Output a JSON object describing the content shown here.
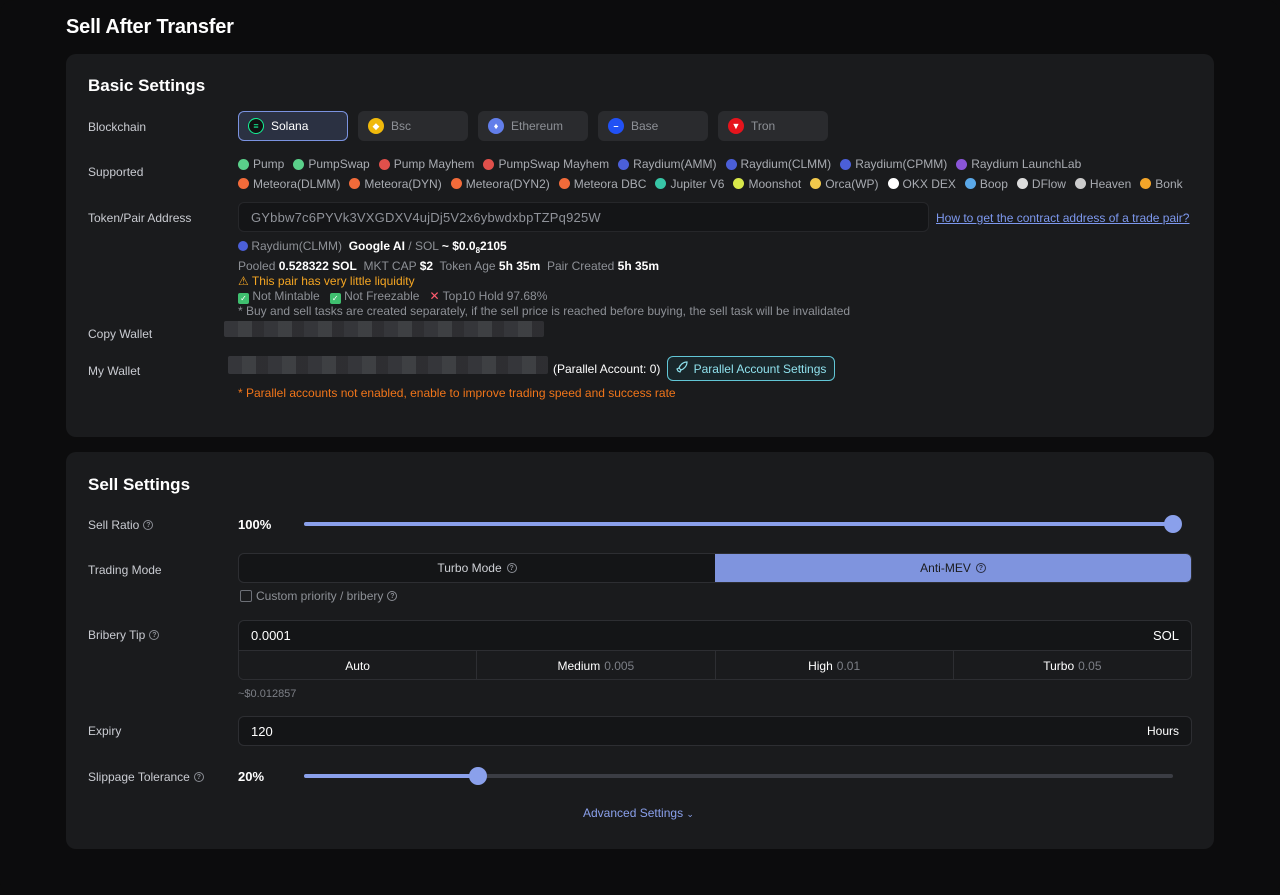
{
  "page": {
    "title": "Sell After Transfer"
  },
  "basic": {
    "title": "Basic Settings",
    "labels": {
      "blockchain": "Blockchain",
      "supported": "Supported",
      "token": "Token/Pair Address",
      "copy_wallet": "Copy Wallet",
      "my_wallet": "My Wallet"
    },
    "chains": [
      {
        "label": "Solana",
        "icon": "solana-icon",
        "color": "#14f195",
        "active": true
      },
      {
        "label": "Bsc",
        "icon": "bnb-icon",
        "color": "#f0b90b",
        "active": false
      },
      {
        "label": "Ethereum",
        "icon": "ethereum-icon",
        "color": "#627eea",
        "active": false
      },
      {
        "label": "Base",
        "icon": "base-icon",
        "color": "#2151f5",
        "active": false
      },
      {
        "label": "Tron",
        "icon": "tron-icon",
        "color": "#e5141c",
        "active": false
      }
    ],
    "dexes": [
      {
        "label": "Pump",
        "color": "#5ad08a"
      },
      {
        "label": "PumpSwap",
        "color": "#5ad08a"
      },
      {
        "label": "Pump Mayhem",
        "color": "#e0504b"
      },
      {
        "label": "PumpSwap Mayhem",
        "color": "#e0504b"
      },
      {
        "label": "Raydium(AMM)",
        "color": "#4b5fd8"
      },
      {
        "label": "Raydium(CLMM)",
        "color": "#4b5fd8"
      },
      {
        "label": "Raydium(CPMM)",
        "color": "#4b5fd8"
      },
      {
        "label": "Raydium LaunchLab",
        "color": "#8a55d8"
      },
      {
        "label": "Meteora(DLMM)",
        "color": "#f26b3a"
      },
      {
        "label": "Meteora(DYN)",
        "color": "#f26b3a"
      },
      {
        "label": "Meteora(DYN2)",
        "color": "#f26b3a"
      },
      {
        "label": "Meteora DBC",
        "color": "#f26b3a"
      },
      {
        "label": "Jupiter V6",
        "color": "#37c5a6"
      },
      {
        "label": "Moonshot",
        "color": "#d8e84a"
      },
      {
        "label": "Orca(WP)",
        "color": "#f2c94c"
      },
      {
        "label": "OKX DEX",
        "color": "#ffffff"
      },
      {
        "label": "Boop",
        "color": "#5aa8e8"
      },
      {
        "label": "DFlow",
        "color": "#dddddd"
      },
      {
        "label": "Heaven",
        "color": "#cccccc"
      },
      {
        "label": "Bonk",
        "color": "#f3a529"
      }
    ],
    "token": {
      "value": "GYbbw7c6PYVk3VXGDXV4ujDj5V2x6ybwdxbpTZPq925W",
      "help_link": "How to get the contract address of a trade pair?",
      "pool": "Raydium(CLMM)",
      "pair_name": "Google AI",
      "pair_quote": " / SOL",
      "price_prefix": "~ $0.0",
      "price_sub": "8",
      "price_suffix": "2105",
      "pooled_label": "Pooled",
      "pooled_value": "0.528322 SOL",
      "mktcap_label": "MKT CAP",
      "mktcap_value": "$2",
      "age_label": "Token Age",
      "age_value": "5h 35m",
      "created_label": "Pair Created",
      "created_value": "5h 35m",
      "warning": "This pair has very little liquidity",
      "not_mintable": "Not Mintable",
      "not_freezable": "Not Freezable",
      "top10": "Top10 Hold 97.68%",
      "note": "* Buy and sell tasks are created separately, if the sell price is reached before buying, the sell task will be invalidated"
    },
    "parallel": {
      "count_text": "(Parallel Account: 0)",
      "button": "Parallel Account Settings",
      "note": "* Parallel accounts not enabled, enable to improve trading speed and success rate"
    }
  },
  "sell": {
    "title": "Sell Settings",
    "labels": {
      "ratio": "Sell Ratio",
      "mode": "Trading Mode",
      "tip": "Bribery Tip",
      "expiry": "Expiry",
      "slippage": "Slippage Tolerance"
    },
    "ratio": {
      "text": "100%",
      "value": 1.0
    },
    "modes": [
      {
        "label": "Turbo Mode",
        "active": false
      },
      {
        "label": "Anti-MEV",
        "active": true
      }
    ],
    "custom_priority": "Custom priority / bribery",
    "tip": {
      "value": "0.0001",
      "unit": "SOL",
      "usd": "~$0.012857",
      "levels": [
        {
          "label": "Auto",
          "value": ""
        },
        {
          "label": "Medium",
          "value": "0.005"
        },
        {
          "label": "High",
          "value": "0.01"
        },
        {
          "label": "Turbo",
          "value": "0.05"
        }
      ]
    },
    "expiry": {
      "value": "120",
      "unit": "Hours"
    },
    "slippage": {
      "text": "20%",
      "value": 0.2
    },
    "advanced": "Advanced Settings"
  }
}
